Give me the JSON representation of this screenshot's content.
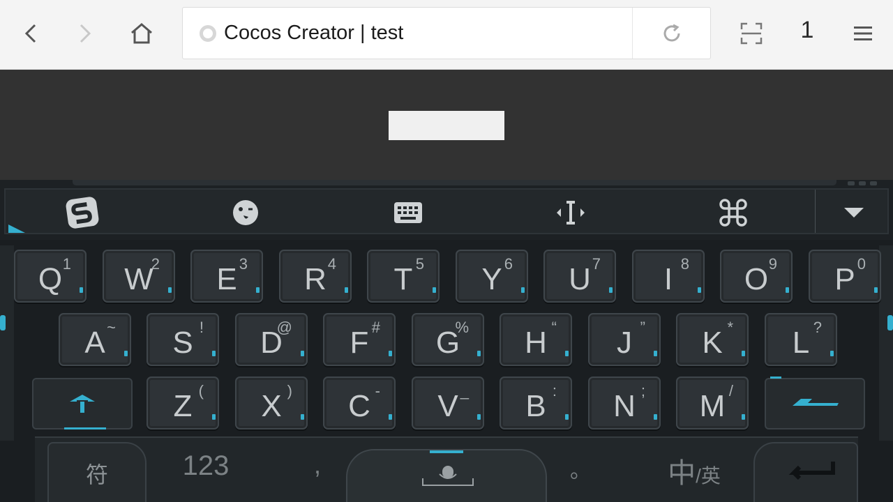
{
  "browser": {
    "url_title": "Cocos Creator | test",
    "tab_count": "1",
    "icons": {
      "back": "chevron-left-icon",
      "forward": "chevron-right-icon",
      "home": "home-icon",
      "reload": "reload-icon",
      "reader": "reader-mode-icon",
      "menu": "hamburger-menu-icon"
    }
  },
  "keyboard": {
    "accent_color": "#35b0cf",
    "row1": [
      {
        "key": "Q",
        "sub": "1"
      },
      {
        "key": "W",
        "sub": "2"
      },
      {
        "key": "E",
        "sub": "3"
      },
      {
        "key": "R",
        "sub": "4"
      },
      {
        "key": "T",
        "sub": "5"
      },
      {
        "key": "Y",
        "sub": "6"
      },
      {
        "key": "U",
        "sub": "7"
      },
      {
        "key": "I",
        "sub": "8"
      },
      {
        "key": "O",
        "sub": "9"
      },
      {
        "key": "P",
        "sub": "0"
      }
    ],
    "row2": [
      {
        "key": "A",
        "sub": "~"
      },
      {
        "key": "S",
        "sub": "!"
      },
      {
        "key": "D",
        "sub": "@"
      },
      {
        "key": "F",
        "sub": "#"
      },
      {
        "key": "G",
        "sub": "%"
      },
      {
        "key": "H",
        "sub": "“"
      },
      {
        "key": "J",
        "sub": "”"
      },
      {
        "key": "K",
        "sub": "*"
      },
      {
        "key": "L",
        "sub": "?"
      }
    ],
    "row3": [
      {
        "key": "Z",
        "sub": "("
      },
      {
        "key": "X",
        "sub": ")"
      },
      {
        "key": "C",
        "sub": "-"
      },
      {
        "key": "V",
        "sub": "_"
      },
      {
        "key": "B",
        "sub": ":"
      },
      {
        "key": "N",
        "sub": ";"
      },
      {
        "key": "M",
        "sub": "/"
      }
    ],
    "symbols_label": "符",
    "numbers_label": "123",
    "comma_label": ",",
    "period_label": "。",
    "lang_label_main": "中",
    "lang_label_sep": "/英"
  }
}
